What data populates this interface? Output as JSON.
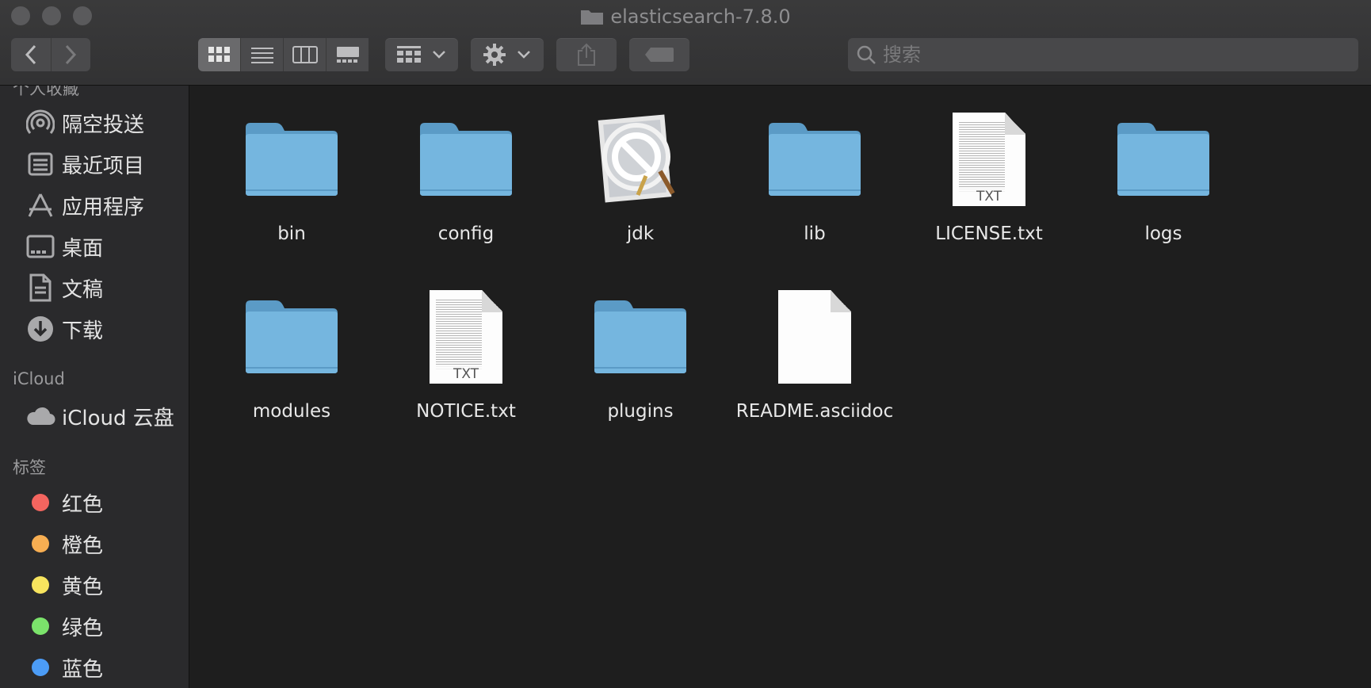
{
  "window": {
    "title": "elasticsearch-7.8.0"
  },
  "toolbar": {
    "nav": [
      "back-icon",
      "forward-icon"
    ],
    "view_modes": [
      "icon-view",
      "list-view",
      "column-view",
      "gallery-view"
    ],
    "search_placeholder": "搜索"
  },
  "sidebar": {
    "favorites_header": "个人收藏",
    "favorites": [
      {
        "label": "隔空投送",
        "icon": "airdrop-icon"
      },
      {
        "label": "最近项目",
        "icon": "recents-icon"
      },
      {
        "label": "应用程序",
        "icon": "applications-icon"
      },
      {
        "label": "桌面",
        "icon": "desktop-icon"
      },
      {
        "label": "文稿",
        "icon": "documents-icon"
      },
      {
        "label": "下载",
        "icon": "downloads-icon"
      }
    ],
    "icloud_header": "iCloud",
    "icloud": [
      {
        "label": "iCloud 云盘",
        "icon": "cloud-icon"
      }
    ],
    "tags_header": "标签",
    "tags": [
      {
        "label": "红色",
        "color": "#f4655f"
      },
      {
        "label": "橙色",
        "color": "#f7ae52"
      },
      {
        "label": "黄色",
        "color": "#f7e45e"
      },
      {
        "label": "绿色",
        "color": "#7be36b"
      },
      {
        "label": "蓝色",
        "color": "#4c9cf6"
      }
    ]
  },
  "files": [
    {
      "name": "bin",
      "type": "folder"
    },
    {
      "name": "config",
      "type": "folder"
    },
    {
      "name": "jdk",
      "type": "app-disabled"
    },
    {
      "name": "lib",
      "type": "folder"
    },
    {
      "name": "LICENSE.txt",
      "type": "txt",
      "badge": "TXT"
    },
    {
      "name": "logs",
      "type": "folder"
    },
    {
      "name": "modules",
      "type": "folder"
    },
    {
      "name": "NOTICE.txt",
      "type": "txt",
      "badge": "TXT"
    },
    {
      "name": "plugins",
      "type": "folder"
    },
    {
      "name": "README.asciidoc",
      "type": "document"
    }
  ]
}
